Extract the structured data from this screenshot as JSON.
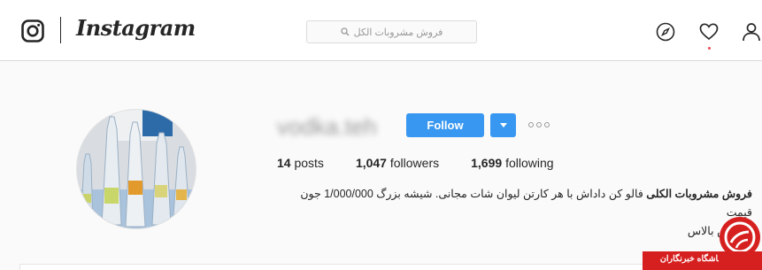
{
  "nav": {
    "brand": "Instagram",
    "search_placeholder": "فروش مشروبات الکل"
  },
  "profile": {
    "username": "vodka.teh",
    "follow_label": "Follow",
    "stats": {
      "posts_count": "14",
      "posts_label": "posts",
      "followers_count": "1,047",
      "followers_label": "followers",
      "following_count": "1,699",
      "following_label": "following"
    },
    "bio": {
      "title": "فروش مشروبات الکلی",
      "line1": "فالو کن داداش با هر کارتن لیوان شات مجانی. شیشه بزرگ 1/000/000 جون قیمت",
      "line2": "خریدش بالاس"
    }
  },
  "watermark": {
    "text": "باشگاه خبرنگاران"
  },
  "colors": {
    "follow_blue": "#3897f0",
    "watermark_red": "#d62020"
  }
}
